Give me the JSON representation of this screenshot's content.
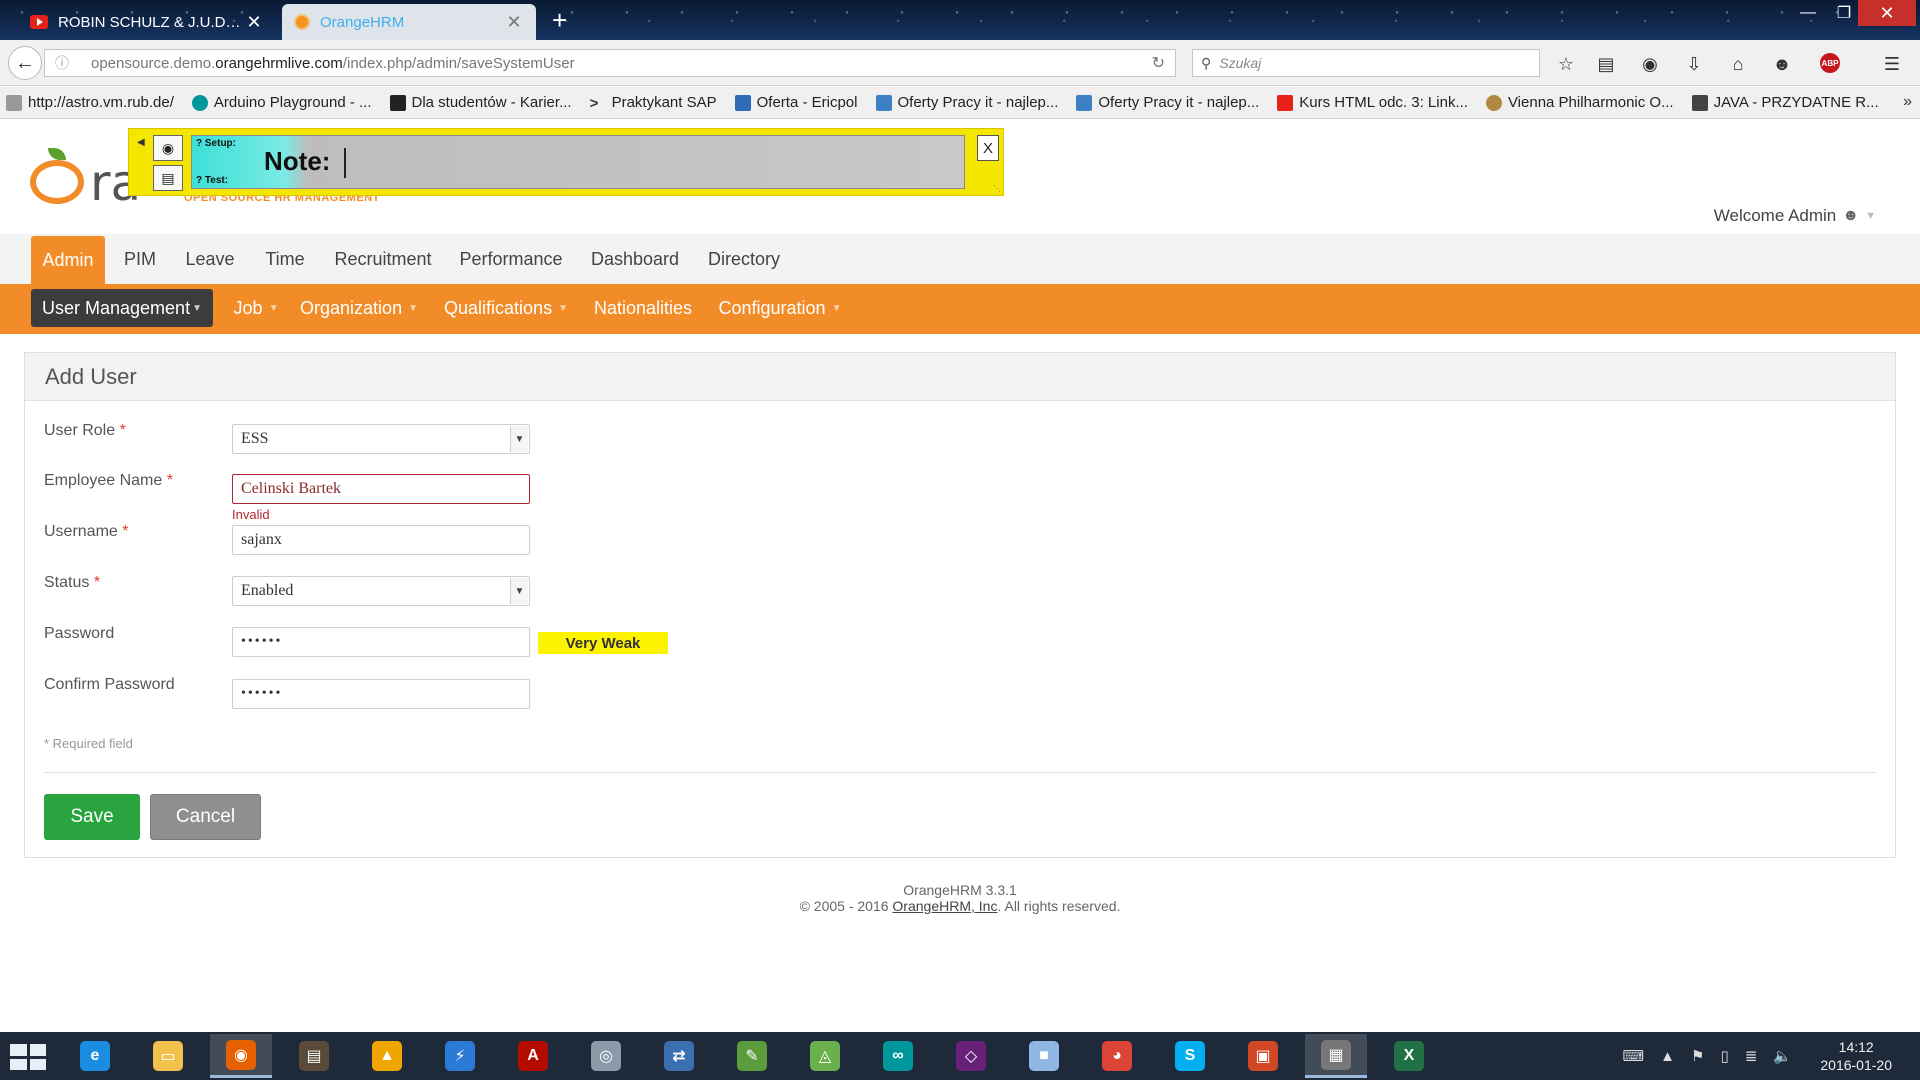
{
  "browser": {
    "tabs": [
      {
        "title": "ROBIN SCHULZ & J.U.D.G...",
        "close": "✕"
      },
      {
        "title": "OrangeHRM",
        "close": "✕"
      }
    ],
    "new_tab": "+",
    "window": {
      "minimize": "—",
      "maximize": "❐",
      "close": "✕"
    },
    "url_prefix": "opensource.demo.",
    "url_host": "orangehrmlive.com",
    "url_path": "/index.php/admin/saveSystemUser",
    "search_placeholder": "Szukaj",
    "bookmarks": [
      {
        "label": "http://astro.vm.rub.de/",
        "color": "#999999"
      },
      {
        "label": "Arduino Playground - ...",
        "color": "#00979c"
      },
      {
        "label": "Dla studentów - Karier...",
        "color": "#222222"
      },
      {
        "label": "Praktykant SAP",
        "color": "#333333"
      },
      {
        "label": "Oferta - Ericpol",
        "color": "#2f6bb5"
      },
      {
        "label": "Oferty Pracy it - najlep...",
        "color": "#3b7fc4"
      },
      {
        "label": "Oferty Pracy it - najlep...",
        "color": "#3b7fc4"
      },
      {
        "label": "Kurs HTML odc. 3: Link...",
        "color": "#e62117"
      },
      {
        "label": "Vienna Philharmonic O...",
        "color": "#b08a3e"
      },
      {
        "label": "JAVA - PRZYDATNE R...",
        "color": "#444444"
      }
    ]
  },
  "note_widget": {
    "setup": "? Setup:",
    "test": "? Test:",
    "label": "Note:",
    "close": "X"
  },
  "header": {
    "logo_text": "ra",
    "tagline": "OPEN SOURCE HR MANAGEMENT",
    "welcome": "Welcome Admin"
  },
  "main_menu": [
    "Admin",
    "PIM",
    "Leave",
    "Time",
    "Recruitment",
    "Performance",
    "Dashboard",
    "Directory"
  ],
  "sub_menu": [
    "User Management",
    "Job",
    "Organization",
    "Qualifications",
    "Nationalities",
    "Configuration"
  ],
  "form": {
    "title": "Add User",
    "user_role_label": "User Role",
    "user_role_value": "ESS",
    "employee_name_label": "Employee Name",
    "employee_name_value": "Celinski Bartek",
    "employee_name_error": "Invalid",
    "username_label": "Username",
    "username_value": "sajanx",
    "status_label": "Status",
    "status_value": "Enabled",
    "password_label": "Password",
    "password_value": "••••••",
    "password_strength": "Very Weak",
    "confirm_label": "Confirm Password",
    "confirm_value": "••••••",
    "required_star": "*",
    "required_note": "* Required field",
    "save": "Save",
    "cancel": "Cancel"
  },
  "footer": {
    "version": "OrangeHRM 3.3.1",
    "copyright_prefix": "© 2005 - 2016 ",
    "company": "OrangeHRM, Inc",
    "copyright_suffix": ". All rights reserved."
  },
  "taskbar": {
    "apps": [
      {
        "name": "internet-explorer",
        "glyph": "e",
        "color": "#1b8de0"
      },
      {
        "name": "file-explorer",
        "glyph": "▭",
        "color": "#f2c14e"
      },
      {
        "name": "firefox",
        "glyph": "◉",
        "color": "#e66000"
      },
      {
        "name": "app-4",
        "glyph": "▤",
        "color": "#5a4a3a"
      },
      {
        "name": "app-5",
        "glyph": "▲",
        "color": "#f0a500"
      },
      {
        "name": "app-6",
        "glyph": "⚡",
        "color": "#2a7ad8"
      },
      {
        "name": "acrobat",
        "glyph": "A",
        "color": "#b30b00"
      },
      {
        "name": "app-8",
        "glyph": "◎",
        "color": "#8a9aa8"
      },
      {
        "name": "app-9",
        "glyph": "⇄",
        "color": "#3a6fb0"
      },
      {
        "name": "app-10",
        "glyph": "✎",
        "color": "#5b9b3a"
      },
      {
        "name": "android-studio",
        "glyph": "◬",
        "color": "#6ab04c"
      },
      {
        "name": "arduino",
        "glyph": "∞",
        "color": "#00979c"
      },
      {
        "name": "visual-studio",
        "glyph": "◇",
        "color": "#68217a"
      },
      {
        "name": "app-14",
        "glyph": "■",
        "color": "#8fb7e3"
      },
      {
        "name": "chrome",
        "glyph": "◕",
        "color": "#db4437"
      },
      {
        "name": "skype",
        "glyph": "S",
        "color": "#00aff0"
      },
      {
        "name": "app-17",
        "glyph": "▣",
        "color": "#d24726"
      },
      {
        "name": "app-18",
        "glyph": "▦",
        "color": "#777777"
      },
      {
        "name": "excel",
        "glyph": "X",
        "color": "#207245"
      }
    ],
    "time": "14:12",
    "date": "2016-01-20"
  }
}
